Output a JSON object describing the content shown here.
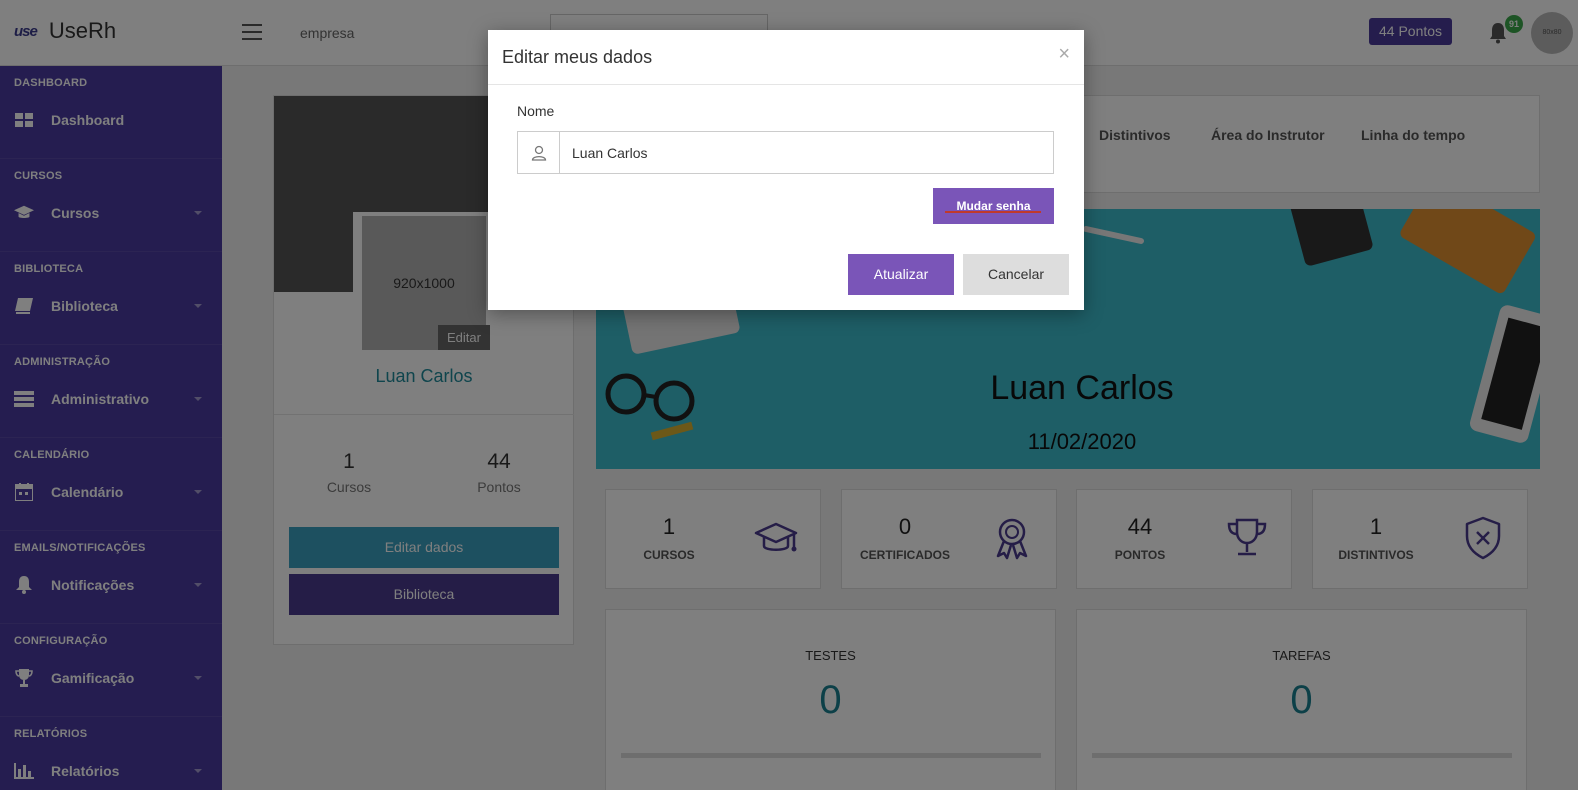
{
  "header": {
    "logo_text": "use",
    "app_name": "UseRh",
    "company": "empresa",
    "points_badge": "44 Pontos",
    "notification_count": "91",
    "avatar_text": "80x80"
  },
  "sidebar": {
    "sections": [
      {
        "header": "DASHBOARD",
        "item": "Dashboard",
        "icon": "grid-icon"
      },
      {
        "header": "CURSOS",
        "item": "Cursos",
        "icon": "graduation-cap-icon"
      },
      {
        "header": "BIBLIOTECA",
        "item": "Biblioteca",
        "icon": "book-icon"
      },
      {
        "header": "ADMINISTRAÇÃO",
        "item": "Administrativo",
        "icon": "server-icon"
      },
      {
        "header": "CALENDÁRIO",
        "item": "Calendário",
        "icon": "calendar-icon"
      },
      {
        "header": "EMAILS/NOTIFICAÇÕES",
        "item": "Notificações",
        "icon": "bell-icon"
      },
      {
        "header": "CONFIGURAÇÃO",
        "item": "Gamificação",
        "icon": "trophy-icon"
      },
      {
        "header": "RELATÓRIOS",
        "item": "Relatórios",
        "icon": "bar-chart-icon"
      }
    ]
  },
  "profile": {
    "photo_placeholder": "920x1000",
    "photo_edit": "Editar",
    "name": "Luan Carlos",
    "stats": [
      {
        "value": "1",
        "label": "Cursos"
      },
      {
        "value": "44",
        "label": "Pontos"
      }
    ],
    "edit_button": "Editar dados",
    "library_button": "Biblioteca"
  },
  "tabs": [
    "Distintivos",
    "Área do Instrutor",
    "Linha do tempo"
  ],
  "banner": {
    "name": "Luan Carlos",
    "date": "11/02/2020"
  },
  "stat_cards": [
    {
      "value": "1",
      "label": "CURSOS",
      "icon": "graduation-cap-icon"
    },
    {
      "value": "0",
      "label": "CERTIFICADOS",
      "icon": "award-icon"
    },
    {
      "value": "44",
      "label": "PONTOS",
      "icon": "trophy-icon"
    },
    {
      "value": "1",
      "label": "DISTINTIVOS",
      "icon": "shield-x-icon"
    }
  ],
  "big_cards": [
    {
      "title": "TESTES",
      "value": "0"
    },
    {
      "title": "TAREFAS",
      "value": "0"
    }
  ],
  "modal": {
    "title": "Editar meus dados",
    "close": "×",
    "name_label": "Nome",
    "name_value": "Luan Carlos",
    "change_password": "Mudar senha",
    "update": "Atualizar",
    "cancel": "Cancelar"
  },
  "colors": {
    "sidebar_bg": "#4a3aa0",
    "primary_purple": "#7a55b8",
    "banner_teal": "#3cbccc",
    "accent_teal": "#1a8090"
  }
}
